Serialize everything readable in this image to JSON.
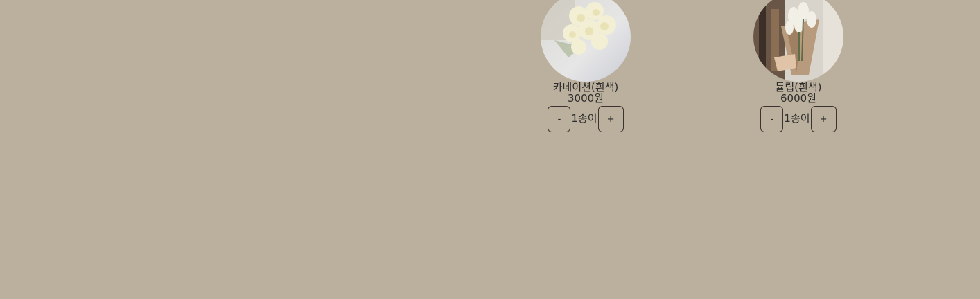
{
  "colors": {
    "background": "#bbb09e",
    "text": "#2b2b2b",
    "button_border": "#3a3530"
  },
  "products": [
    {
      "name": "카네이션(흰색)",
      "price": "3000원",
      "quantity": "1송이",
      "minus_label": "-",
      "plus_label": "+",
      "image_alt": "white carnation bouquet photo"
    },
    {
      "name": "튤립(흰색)",
      "price": "6000원",
      "quantity": "1송이",
      "minus_label": "-",
      "plus_label": "+",
      "image_alt": "white tulip bouquet photo"
    }
  ]
}
